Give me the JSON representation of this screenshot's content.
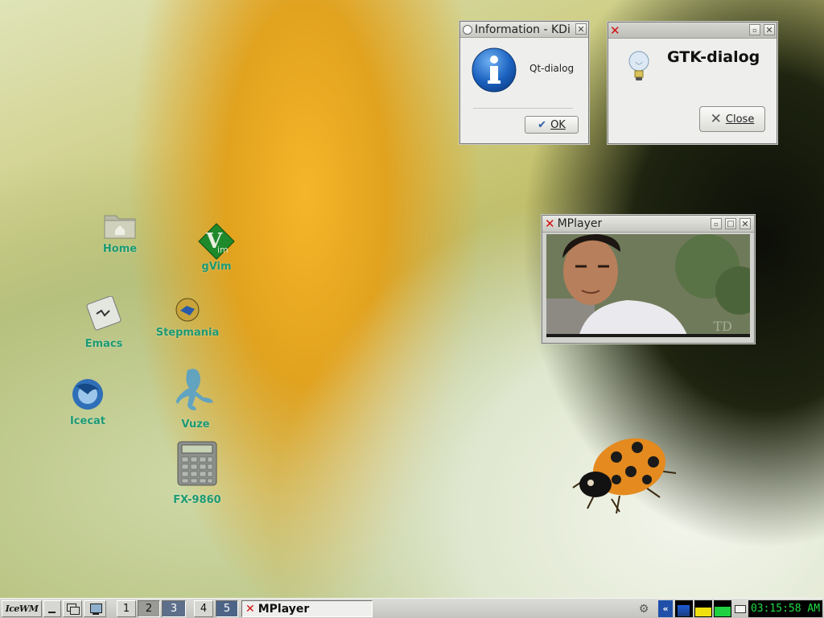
{
  "desktop": {
    "icons": [
      {
        "label": "Home"
      },
      {
        "label": "gVim"
      },
      {
        "label": "Emacs"
      },
      {
        "label": "Stepmania"
      },
      {
        "label": "Icecat"
      },
      {
        "label": "Vuze"
      },
      {
        "label": "FX-9860"
      }
    ]
  },
  "kde_dialog": {
    "title": "Information - KDi",
    "message": "Qt-dialog",
    "ok_label": "OK"
  },
  "gtk_dialog": {
    "title": "",
    "heading": "GTK-dialog",
    "close_label": "Close"
  },
  "mplayer": {
    "title": "MPlayer",
    "watermark": "TD"
  },
  "taskbar": {
    "start_label": "IceWM",
    "workspaces": [
      "1",
      "2",
      "3",
      "4",
      "5"
    ],
    "active_workspace": "5",
    "task_label": "MPlayer",
    "clock": "03:15:58 AM"
  },
  "colors": {
    "icon_label": "#1c9a73",
    "clock_bg": "#000000",
    "clock_fg": "#22dd44"
  }
}
